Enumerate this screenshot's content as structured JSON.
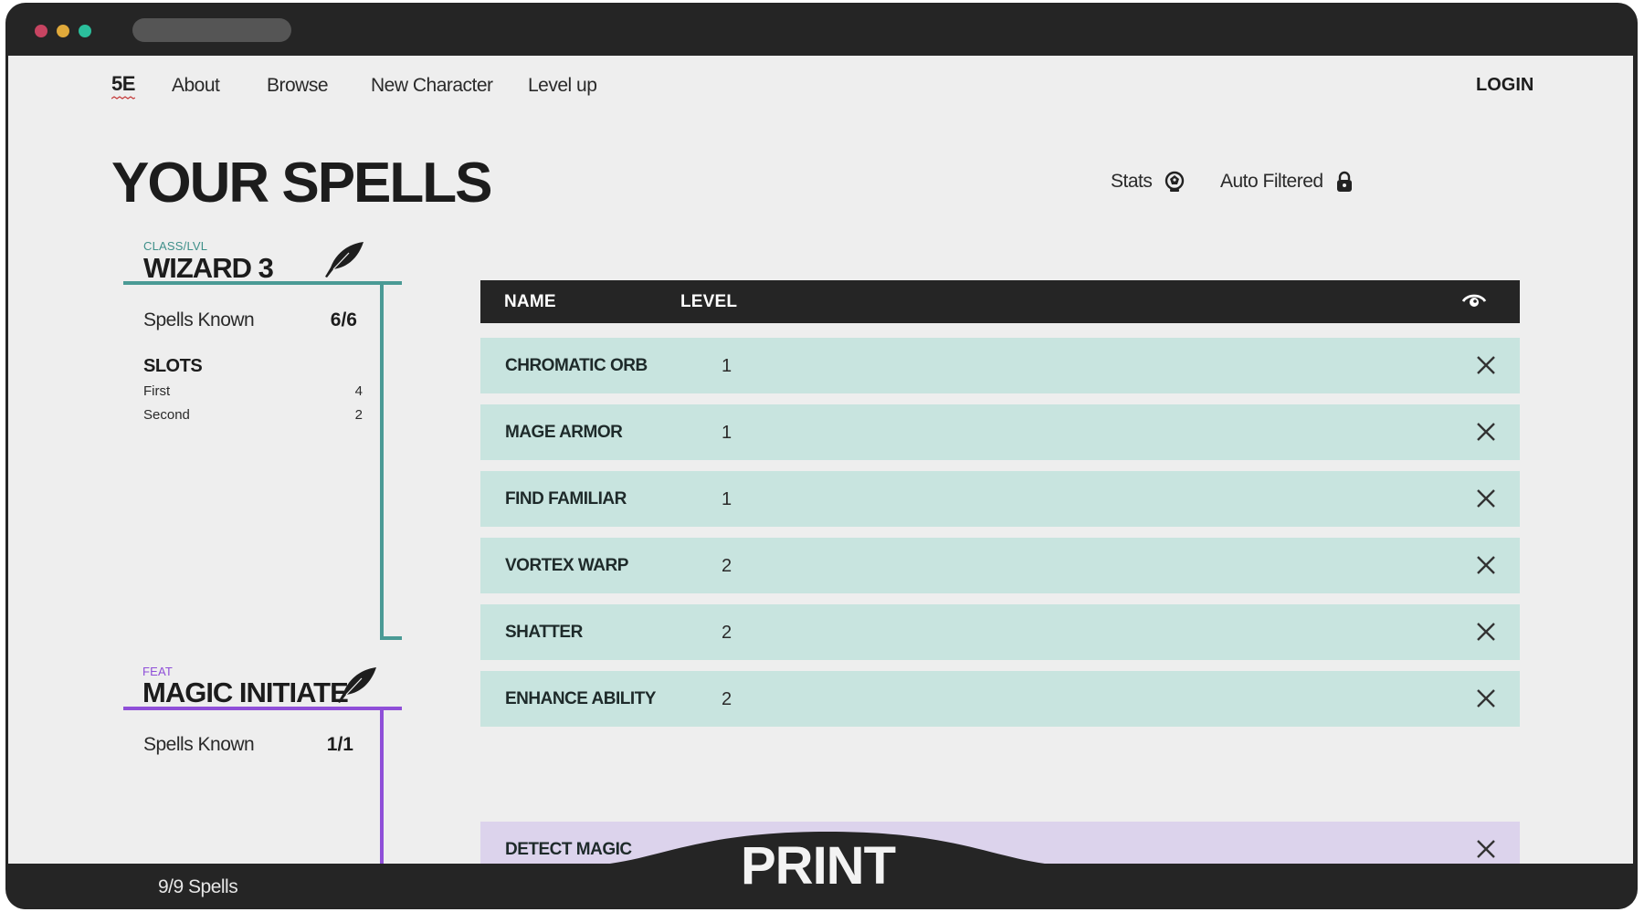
{
  "nav": {
    "logo": "5E",
    "links": [
      "About",
      "Browse",
      "New Character",
      "Level up"
    ],
    "login": "LOGIN"
  },
  "page_title": "YOUR SPELLS",
  "tools": {
    "stats_label": "Stats",
    "stats_icon": "dice-icon",
    "filter_label": "Auto Filtered",
    "filter_icon": "lock-icon"
  },
  "groups": [
    {
      "tag": "CLASS/LVL",
      "name": "WIZARD 3",
      "accent": "#4a9a95",
      "spells_known_label": "Spells Known",
      "spells_known_value": "6/6",
      "slots_heading": "SLOTS",
      "slots": [
        {
          "label": "First",
          "value": "4"
        },
        {
          "label": "Second",
          "value": "2"
        }
      ]
    },
    {
      "tag": "FEAT",
      "name": "MAGIC INITIATE",
      "accent": "#8f4fd8",
      "spells_known_label": "Spells Known",
      "spells_known_value": "1/1"
    }
  ],
  "table": {
    "headers": {
      "name": "NAME",
      "level": "LEVEL"
    },
    "visibility_icon": "eye-icon",
    "rows": [
      {
        "name": "CHROMATIC ORB",
        "level": "1",
        "group": "wizard"
      },
      {
        "name": "MAGE ARMOR",
        "level": "1",
        "group": "wizard"
      },
      {
        "name": "FIND FAMILIAR",
        "level": "1",
        "group": "wizard"
      },
      {
        "name": "VORTEX WARP",
        "level": "2",
        "group": "wizard"
      },
      {
        "name": "SHATTER",
        "level": "2",
        "group": "wizard"
      },
      {
        "name": "ENHANCE ABILITY",
        "level": "2",
        "group": "wizard"
      },
      {
        "name": "DETECT MAGIC",
        "level": "",
        "group": "magic-initiate"
      }
    ]
  },
  "footer": {
    "spell_count": "9/9 Spells",
    "print_label": "PRINT"
  },
  "colors": {
    "wizard_row": "#c8e4df",
    "initiate_row": "#dcd3ec",
    "dark": "#252525"
  }
}
